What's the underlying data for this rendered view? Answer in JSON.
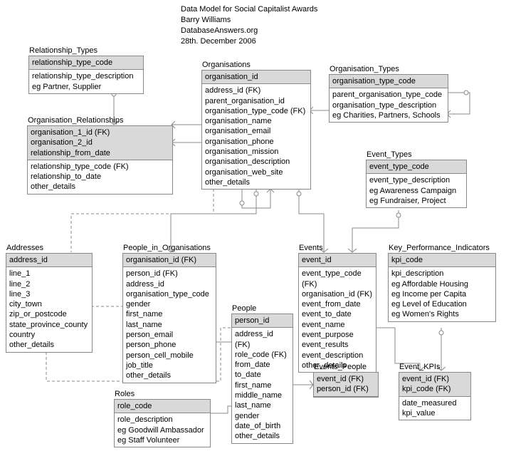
{
  "header": {
    "title": "Data Model for Social Capitalist Awards",
    "author": "Barry Williams",
    "site": "DatabaseAnswers.org",
    "date": "28th. December 2006"
  },
  "entities": {
    "relationship_types": {
      "name": "Relationship_Types",
      "pk": [
        "relationship_type_code"
      ],
      "attrs": [
        "relationship_type_description",
        "eg Partner, Supplier"
      ]
    },
    "organisation_relationships": {
      "name": "Organisation_Relationships",
      "pk": [
        "organisation_1_id (FK)",
        "organisation_2_id",
        "relationship_from_date"
      ],
      "attrs": [
        "relationship_type_code (FK)",
        "relationship_to_date",
        "other_details"
      ]
    },
    "organisations": {
      "name": "Organisations",
      "pk": [
        "organisation_id"
      ],
      "attrs": [
        "address_id (FK)",
        "parent_organisation_id",
        "organisation_type_code (FK)",
        "organisation_name",
        "organisation_email",
        "organisation_phone",
        "organisation_mission",
        "organisation_description",
        "organisation_web_site",
        "other_details"
      ]
    },
    "organisation_types": {
      "name": "Organisation_Types",
      "pk": [
        "organisation_type_code"
      ],
      "attrs": [
        "parent_organisation_type_code",
        "organisation_type_description",
        "eg Charities, Partners, Schools"
      ]
    },
    "event_types": {
      "name": "Event_Types",
      "pk": [
        "event_type_code"
      ],
      "attrs": [
        "event_type_description",
        "eg Awareness Campaign",
        "eg Fundraiser, Project"
      ]
    },
    "addresses": {
      "name": "Addresses",
      "pk": [
        "address_id"
      ],
      "attrs": [
        "line_1",
        "line_2",
        "line_3",
        "city_town",
        "zip_or_postcode",
        "state_province_county",
        "country",
        "other_details"
      ]
    },
    "people_in_organisations": {
      "name": "People_in_Organisations",
      "pk": [
        "organisation_id (FK)"
      ],
      "attrs": [
        "person_id (FK)",
        "address_id",
        "organisation_type_code",
        "gender",
        "first_name",
        "last_name",
        "person_email",
        "person_phone",
        "person_cell_mobile",
        "job_title",
        "other_details"
      ]
    },
    "people": {
      "name": "People",
      "pk": [
        "person_id"
      ],
      "attrs": [
        "address_id (FK)",
        "role_code (FK)",
        "from_date",
        "to_date",
        "first_name",
        "middle_name",
        "last_name",
        "gender",
        "date_of_birth",
        "other_details"
      ]
    },
    "events": {
      "name": "Events",
      "pk": [
        "event_id"
      ],
      "attrs": [
        "event_type_code (FK)",
        "organisation_id (FK)",
        "event_from_date",
        "event_to_date",
        "event_name",
        "event_purpose",
        "event_results",
        "event_description",
        "other_details"
      ]
    },
    "key_performance_indicators": {
      "name": "Key_Performance_Indicators",
      "pk": [
        "kpi_code"
      ],
      "attrs": [
        "kpi_description",
        "eg Affordable Housing",
        "eg Income per Capita",
        "eg Level of Education",
        "eg Women's Rights"
      ]
    },
    "events_people": {
      "name": "Events_People",
      "pk": [
        "event_id (FK)",
        "person_id (FK)"
      ],
      "attrs": []
    },
    "event_kpis": {
      "name": "Event_KPIs",
      "pk": [
        "event_id (FK)",
        "kpi_code (FK)"
      ],
      "attrs": [
        "date_measured",
        "kpi_value"
      ]
    },
    "roles": {
      "name": "Roles",
      "pk": [
        "role_code"
      ],
      "attrs": [
        "role_description",
        "eg Goodwill Ambassador",
        "eg Staff Volunteer"
      ]
    }
  }
}
